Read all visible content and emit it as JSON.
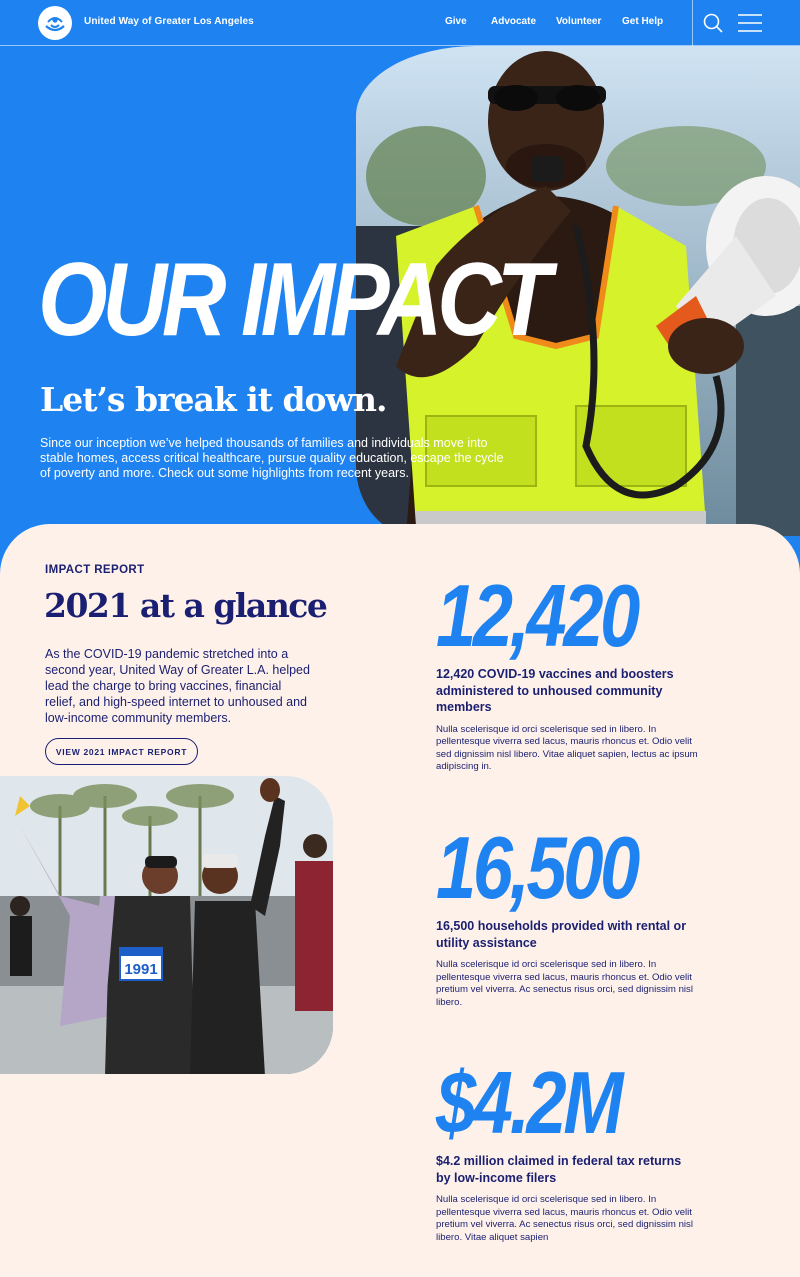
{
  "nav": {
    "org_name": "United Way of Greater Los Angeles",
    "links": [
      {
        "label": "Give"
      },
      {
        "label": "Advocate"
      },
      {
        "label": "Volunteer"
      },
      {
        "label": "Get Help"
      }
    ],
    "search_icon": "search-icon",
    "menu_icon": "hamburger-menu-icon"
  },
  "hero": {
    "title": "OUR IMPACT",
    "subtitle": "Let’s break it down.",
    "description": "Since our inception we’ve helped thousands of families and individuals move into stable homes, access critical healthcare, pursue quality education, escape the cycle of poverty and more. Check out some highlights from recent years."
  },
  "impact": {
    "eyebrow": "IMPACT REPORT",
    "title": "2021 at a glance",
    "body": " As the COVID-19 pandemic stretched into a second year, United Way of Greater L.A. helped lead the charge to bring vaccines, financial relief, and high-speed internet to unhoused and low-income community members.",
    "button_label": "VIEW 2021 IMPACT REPORT",
    "bib_number": "1991",
    "stats": [
      {
        "number": "12,420",
        "heading": "12,420 COVID-19 vaccines and boosters administered to unhoused community members",
        "body": "Nulla scelerisque id orci scelerisque sed in libero. In pellentesque viverra sed lacus, mauris rhoncus et. Odio velit sed dignissim nisl libero. Vitae aliquet sapien, lectus ac ipsum adipiscing in."
      },
      {
        "number": "16,500",
        "heading": "16,500 households provided with rental or utility assistance",
        "body": "Nulla scelerisque id orci scelerisque sed in libero. In pellentesque viverra sed lacus, mauris rhoncus et. Odio velit pretium vel viverra. Ac senectus risus orci, sed dignissim nisl libero."
      },
      {
        "number": "$4.2M",
        "heading": "$4.2 million claimed in federal tax returns by low-income filers",
        "body": "Nulla scelerisque id orci scelerisque sed in libero. In pellentesque viverra sed lacus, mauris rhoncus et. Odio velit pretium vel viverra. Ac senectus risus orci, sed dignissim nisl libero. Vitae aliquet sapien"
      }
    ]
  },
  "colors": {
    "brand_blue": "#1e83f0",
    "navy": "#1a1f71",
    "cream": "#fdf1ea",
    "safety_vest": "#d6f22a"
  }
}
